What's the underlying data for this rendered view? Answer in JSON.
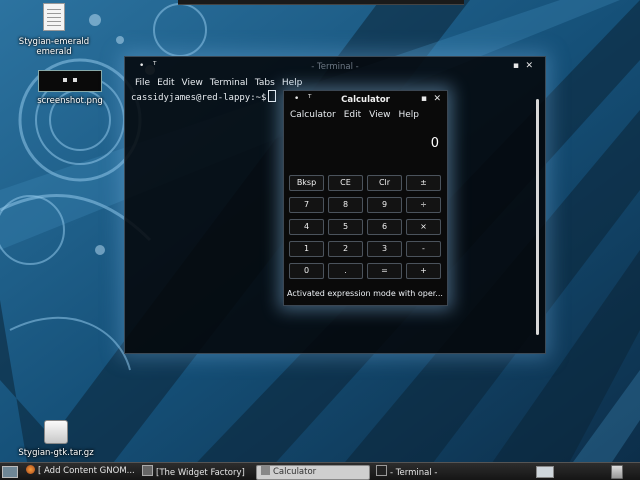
{
  "desktop": {
    "icons": [
      {
        "label_line1": "Stygian-emerald",
        "label_line2": "emerald",
        "icon": "text-document-icon"
      },
      {
        "label": "screenshot.png",
        "icon": "image-thumbnail-icon"
      },
      {
        "label": "Stygian-gtk.tar.gz",
        "icon": "archive-package-icon"
      }
    ]
  },
  "terminal": {
    "title": "Terminal",
    "menu": [
      "File",
      "Edit",
      "View",
      "Terminal",
      "Tabs",
      "Help"
    ],
    "prompt": "cassidyjames@red-lappy:~$",
    "icons": [
      "window-menu-icon",
      "pin-icon",
      "maximize-icon",
      "close-icon"
    ]
  },
  "calculator": {
    "title": "Calculator",
    "menu": [
      "Calculator",
      "Edit",
      "View",
      "Help"
    ],
    "display_value": "0",
    "keys": [
      [
        "Bksp",
        "CE",
        "Clr",
        "±"
      ],
      [
        "7",
        "8",
        "9",
        "÷"
      ],
      [
        "4",
        "5",
        "6",
        "×"
      ],
      [
        "1",
        "2",
        "3",
        "-"
      ],
      [
        "0",
        ".",
        "=",
        "+"
      ]
    ],
    "status": "Activated expression mode with oper..."
  },
  "taskbar": {
    "items": [
      {
        "label": "[ Add Content GNOM...",
        "icon": "firefox-icon"
      },
      {
        "label": "[The Widget Factory]",
        "icon": "window-icon"
      },
      {
        "label": "Calculator",
        "icon": "calculator-icon",
        "active": true
      },
      {
        "label": "- Terminal -",
        "icon": "terminal-icon"
      }
    ]
  },
  "colors": {
    "wallpaper_dark": "#0f3550",
    "wallpaper_light": "#2a6f98",
    "window_glow": "#8cc3f0"
  }
}
